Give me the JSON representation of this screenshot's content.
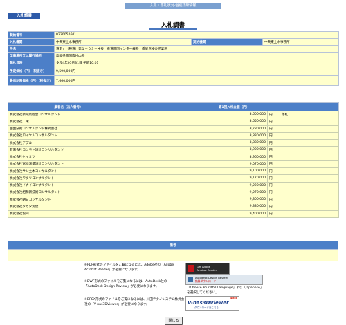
{
  "header": {
    "bar": "入札・落札状況-個別詳細情報",
    "tag": "入札調書",
    "title": "入札調書"
  },
  "info": {
    "contract_no_label": "契約番号",
    "contract_no": "0220052601",
    "bid_org_label": "入札機関",
    "bid_org": "中央東土木事務所",
    "contract_org_label": "契約機関",
    "contract_org": "中央東土木事務所",
    "name_label": "件名",
    "name": "道老止（種道）第１－０３－４号　県道南国インター線外　橋梁点検委託業務",
    "place_label": "工事場所又は履行場所",
    "place": "高知県南国市片山外",
    "opening_label": "開札日時",
    "opening": "令和4年05月31日 午前10:01",
    "estimate_label": "予定価格（円）（税抜き）",
    "estimate": "9,590,000円",
    "minimum_label": "最低制限価格（円）（税抜き）",
    "minimum": "7,660,000円"
  },
  "bids": {
    "col_name": "業者名（法人番号）",
    "col_amount": "第1回入札金額（円）",
    "yen": "円",
    "rows": [
      {
        "name": "株式会社新飛鳥総合コンサルタント",
        "amount": "8,600,000",
        "status": "落札"
      },
      {
        "name": "株式会社工栄",
        "amount": "8,650,000",
        "status": ""
      },
      {
        "name": "國面技術コンサルタント株式会社",
        "amount": "8,780,000",
        "status": ""
      },
      {
        "name": "株式会社ロイヤルコンサルタント",
        "amount": "8,830,000",
        "status": ""
      },
      {
        "name": "株式会社アプル",
        "amount": "8,880,000",
        "status": ""
      },
      {
        "name": "有限会社コンモト設計コンサルタンツ",
        "amount": "8,900,000",
        "status": ""
      },
      {
        "name": "株式会社セイミツ",
        "amount": "8,960,000",
        "status": ""
      },
      {
        "name": "株式会社富崎測量設計コンサルタント",
        "amount": "9,070,000",
        "status": ""
      },
      {
        "name": "株式会社サン土木コンサルタント",
        "amount": "9,100,000",
        "status": ""
      },
      {
        "name": "株式会社ワクリコンサルタント",
        "amount": "9,170,000",
        "status": ""
      },
      {
        "name": "株式会社イナイコンサルタント",
        "amount": "9,220,000",
        "status": ""
      },
      {
        "name": "株式会社相和新技術コンサルタント",
        "amount": "9,270,000",
        "status": ""
      },
      {
        "name": "株式会社朝日コンサルタント",
        "amount": "9,300,000",
        "status": ""
      },
      {
        "name": "株式会社タカタ測建",
        "amount": "9,330,000",
        "status": ""
      },
      {
        "name": "株式会社協同",
        "amount": "9,400,000",
        "status": ""
      }
    ]
  },
  "notes": {
    "header": "備考",
    "body": ""
  },
  "downloads": {
    "pdf_text": "※PDF形式のファイルをご覧になるには、Adobe社の「Adobe Acrobat Reader」が必要になります。",
    "pdf_badge_line1": "Get Adobe",
    "pdf_badge_line2": "Acrobat Reader",
    "dwf_text": "※DWF形式のファイルをご覧になるには、AutoDesk社の「AutoDesk Design Review」が必要になります。",
    "dwf_badge_line1": "Autodesk Design Review",
    "dwf_badge_line2": "無料ダウンロード",
    "dwf_note": "「Choose Your MSI Language」より「Japanese」を選択してください。",
    "sfx_text": "※BFOX形式のファイルをご覧になるには、川田テクノシステム株式会社の「V-nas3DViewer」が必要になります。",
    "sfx_badge_line1": "V-nas3DViewer",
    "sfx_badge_line2": "ダウンロードはこちら",
    "sfx_badge_free": "FREE"
  },
  "close_button": "閉じる",
  "colors": {
    "header_blue": "#4c7fc8",
    "cell_yellow": "#ffffcc",
    "tag_blue": "#2d5aa8"
  }
}
